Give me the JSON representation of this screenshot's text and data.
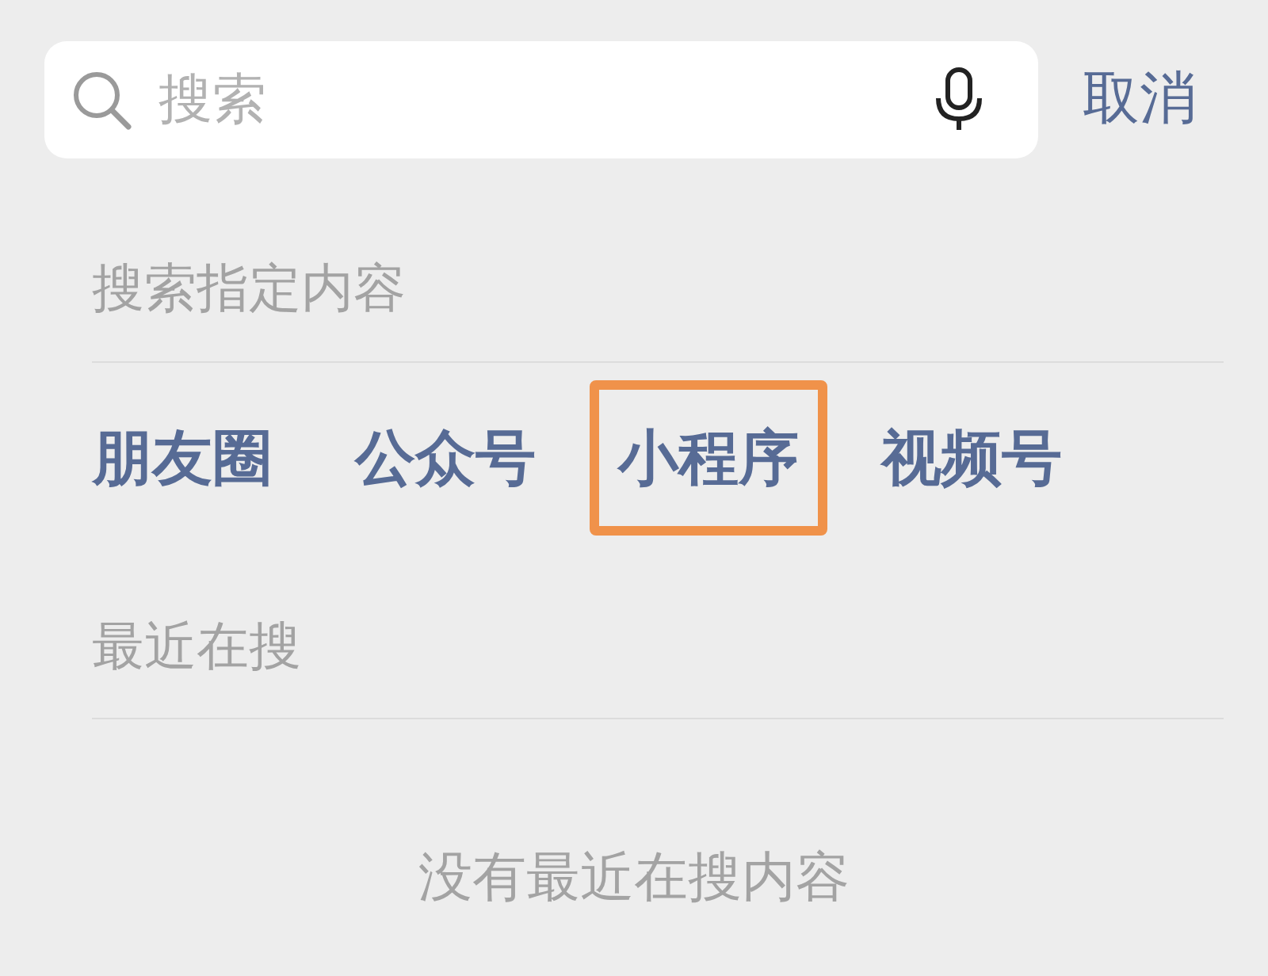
{
  "search": {
    "placeholder": "搜索"
  },
  "cancel": "取消",
  "section_title": "搜索指定内容",
  "categories": [
    {
      "label": "朋友圈",
      "highlighted": false
    },
    {
      "label": "公众号",
      "highlighted": false
    },
    {
      "label": "小程序",
      "highlighted": true
    },
    {
      "label": "视频号",
      "highlighted": false
    }
  ],
  "recent_title": "最近在搜",
  "empty_text": "没有最近在搜内容"
}
